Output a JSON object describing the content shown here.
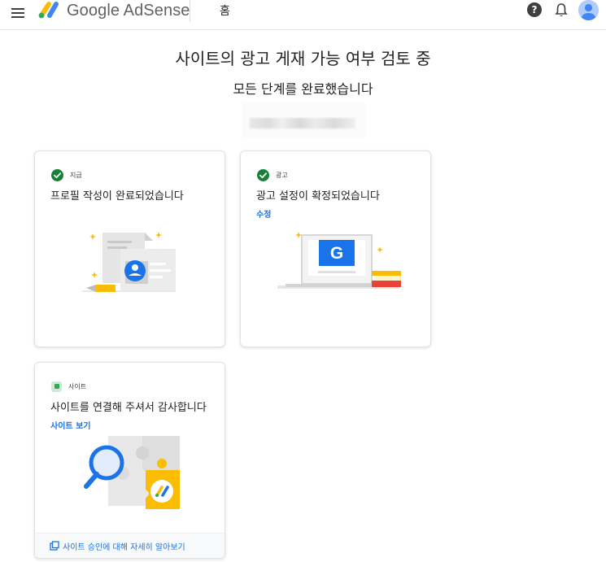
{
  "header": {
    "brand": "Google AdSense",
    "home_tab": "홈",
    "help_symbol": "?"
  },
  "main": {
    "title": "사이트의 광고 게재 가능 여부 검토 중",
    "subtitle": "모든 단계를 완료했습니다"
  },
  "cards": [
    {
      "status": "지급",
      "title": "프로필 작성이 완료되었습니다"
    },
    {
      "status": "광고",
      "title": "광고 설정이 확정되었습니다",
      "link": "수정"
    },
    {
      "status": "사이트",
      "title": "사이트를 연결해 주셔서 감사합니다",
      "link": "사이트 보기",
      "footer": "사이트 승인에 대해 자세히 알아보기"
    }
  ],
  "illustration_text": {
    "g_badge": "G"
  },
  "icons": {
    "menu": "hamburger-menu-icon",
    "logo": "adsense-logo-icon",
    "help": "help-circle-icon",
    "notifications": "bell-icon",
    "account": "account-avatar-icon",
    "done": "check-circle-icon",
    "pending": "pending-square-icon",
    "external": "open-in-new-icon"
  },
  "colors": {
    "accent": "#1a73e8",
    "success": "#188038",
    "yellow": "#fbbc04",
    "red": "#ea4335"
  }
}
